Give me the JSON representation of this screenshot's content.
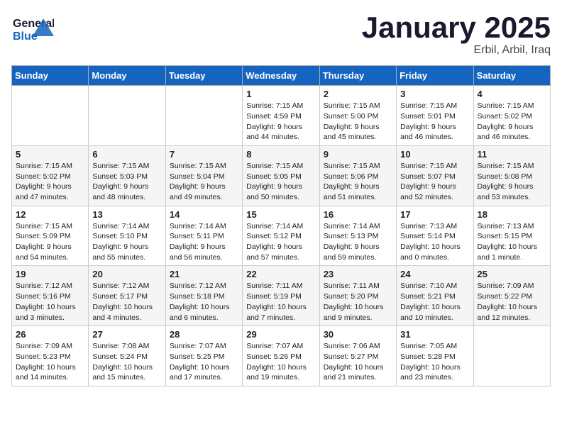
{
  "logo": {
    "line1": "General",
    "line2": "Blue"
  },
  "header": {
    "month": "January 2025",
    "location": "Erbil, Arbil, Iraq"
  },
  "weekdays": [
    "Sunday",
    "Monday",
    "Tuesday",
    "Wednesday",
    "Thursday",
    "Friday",
    "Saturday"
  ],
  "weeks": [
    [
      {
        "day": "",
        "info": ""
      },
      {
        "day": "",
        "info": ""
      },
      {
        "day": "",
        "info": ""
      },
      {
        "day": "1",
        "info": "Sunrise: 7:15 AM\nSunset: 4:59 PM\nDaylight: 9 hours\nand 44 minutes."
      },
      {
        "day": "2",
        "info": "Sunrise: 7:15 AM\nSunset: 5:00 PM\nDaylight: 9 hours\nand 45 minutes."
      },
      {
        "day": "3",
        "info": "Sunrise: 7:15 AM\nSunset: 5:01 PM\nDaylight: 9 hours\nand 46 minutes."
      },
      {
        "day": "4",
        "info": "Sunrise: 7:15 AM\nSunset: 5:02 PM\nDaylight: 9 hours\nand 46 minutes."
      }
    ],
    [
      {
        "day": "5",
        "info": "Sunrise: 7:15 AM\nSunset: 5:02 PM\nDaylight: 9 hours\nand 47 minutes."
      },
      {
        "day": "6",
        "info": "Sunrise: 7:15 AM\nSunset: 5:03 PM\nDaylight: 9 hours\nand 48 minutes."
      },
      {
        "day": "7",
        "info": "Sunrise: 7:15 AM\nSunset: 5:04 PM\nDaylight: 9 hours\nand 49 minutes."
      },
      {
        "day": "8",
        "info": "Sunrise: 7:15 AM\nSunset: 5:05 PM\nDaylight: 9 hours\nand 50 minutes."
      },
      {
        "day": "9",
        "info": "Sunrise: 7:15 AM\nSunset: 5:06 PM\nDaylight: 9 hours\nand 51 minutes."
      },
      {
        "day": "10",
        "info": "Sunrise: 7:15 AM\nSunset: 5:07 PM\nDaylight: 9 hours\nand 52 minutes."
      },
      {
        "day": "11",
        "info": "Sunrise: 7:15 AM\nSunset: 5:08 PM\nDaylight: 9 hours\nand 53 minutes."
      }
    ],
    [
      {
        "day": "12",
        "info": "Sunrise: 7:15 AM\nSunset: 5:09 PM\nDaylight: 9 hours\nand 54 minutes."
      },
      {
        "day": "13",
        "info": "Sunrise: 7:14 AM\nSunset: 5:10 PM\nDaylight: 9 hours\nand 55 minutes."
      },
      {
        "day": "14",
        "info": "Sunrise: 7:14 AM\nSunset: 5:11 PM\nDaylight: 9 hours\nand 56 minutes."
      },
      {
        "day": "15",
        "info": "Sunrise: 7:14 AM\nSunset: 5:12 PM\nDaylight: 9 hours\nand 57 minutes."
      },
      {
        "day": "16",
        "info": "Sunrise: 7:14 AM\nSunset: 5:13 PM\nDaylight: 9 hours\nand 59 minutes."
      },
      {
        "day": "17",
        "info": "Sunrise: 7:13 AM\nSunset: 5:14 PM\nDaylight: 10 hours\nand 0 minutes."
      },
      {
        "day": "18",
        "info": "Sunrise: 7:13 AM\nSunset: 5:15 PM\nDaylight: 10 hours\nand 1 minute."
      }
    ],
    [
      {
        "day": "19",
        "info": "Sunrise: 7:12 AM\nSunset: 5:16 PM\nDaylight: 10 hours\nand 3 minutes."
      },
      {
        "day": "20",
        "info": "Sunrise: 7:12 AM\nSunset: 5:17 PM\nDaylight: 10 hours\nand 4 minutes."
      },
      {
        "day": "21",
        "info": "Sunrise: 7:12 AM\nSunset: 5:18 PM\nDaylight: 10 hours\nand 6 minutes."
      },
      {
        "day": "22",
        "info": "Sunrise: 7:11 AM\nSunset: 5:19 PM\nDaylight: 10 hours\nand 7 minutes."
      },
      {
        "day": "23",
        "info": "Sunrise: 7:11 AM\nSunset: 5:20 PM\nDaylight: 10 hours\nand 9 minutes."
      },
      {
        "day": "24",
        "info": "Sunrise: 7:10 AM\nSunset: 5:21 PM\nDaylight: 10 hours\nand 10 minutes."
      },
      {
        "day": "25",
        "info": "Sunrise: 7:09 AM\nSunset: 5:22 PM\nDaylight: 10 hours\nand 12 minutes."
      }
    ],
    [
      {
        "day": "26",
        "info": "Sunrise: 7:09 AM\nSunset: 5:23 PM\nDaylight: 10 hours\nand 14 minutes."
      },
      {
        "day": "27",
        "info": "Sunrise: 7:08 AM\nSunset: 5:24 PM\nDaylight: 10 hours\nand 15 minutes."
      },
      {
        "day": "28",
        "info": "Sunrise: 7:07 AM\nSunset: 5:25 PM\nDaylight: 10 hours\nand 17 minutes."
      },
      {
        "day": "29",
        "info": "Sunrise: 7:07 AM\nSunset: 5:26 PM\nDaylight: 10 hours\nand 19 minutes."
      },
      {
        "day": "30",
        "info": "Sunrise: 7:06 AM\nSunset: 5:27 PM\nDaylight: 10 hours\nand 21 minutes."
      },
      {
        "day": "31",
        "info": "Sunrise: 7:05 AM\nSunset: 5:28 PM\nDaylight: 10 hours\nand 23 minutes."
      },
      {
        "day": "",
        "info": ""
      }
    ]
  ]
}
